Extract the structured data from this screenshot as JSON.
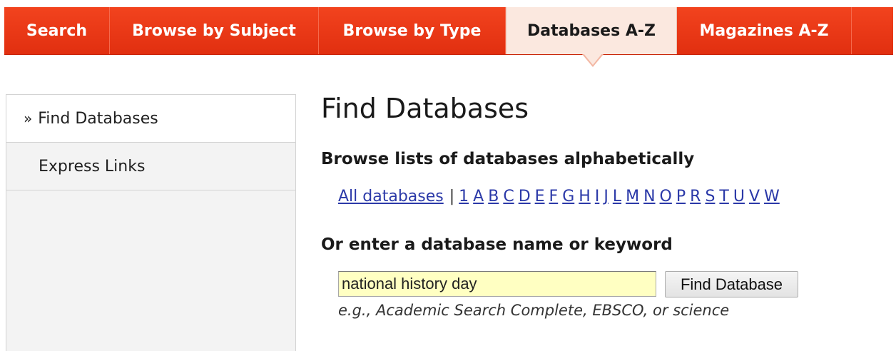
{
  "topnav": {
    "tabs": [
      {
        "label": "Search"
      },
      {
        "label": "Browse by Subject"
      },
      {
        "label": "Browse by Type"
      },
      {
        "label": "Databases A-Z",
        "active": true
      },
      {
        "label": "Magazines A-Z"
      },
      {
        "label": ""
      }
    ],
    "accent_color": "#e8351a"
  },
  "sidebar": {
    "items": [
      {
        "label": "Find Databases",
        "marker": "»",
        "current": true
      },
      {
        "label": "Express Links"
      }
    ]
  },
  "main": {
    "title": "Find Databases",
    "browse_heading": "Browse lists of databases alphabetically",
    "all_databases_link": "All databases",
    "separator": "|",
    "letters": [
      "1",
      "A",
      "B",
      "C",
      "D",
      "E",
      "F",
      "G",
      "H",
      "I",
      "J",
      "L",
      "M",
      "N",
      "O",
      "P",
      "R",
      "S",
      "T",
      "U",
      "V",
      "W"
    ],
    "keyword_heading": "Or enter a database name or keyword",
    "search": {
      "value": "national history day",
      "button_label": "Find Database",
      "hint": "e.g., Academic Search Complete, EBSCO, or science"
    }
  }
}
